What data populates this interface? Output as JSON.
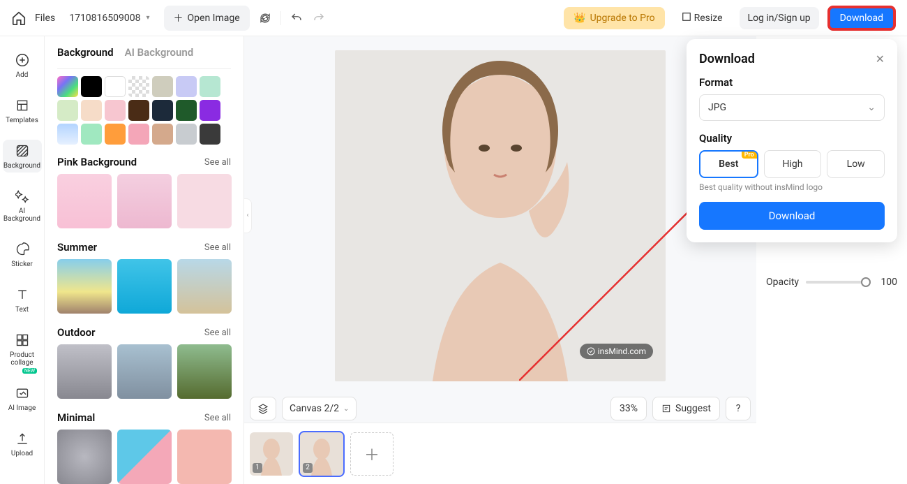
{
  "toolbar": {
    "files": "Files",
    "file_name": "1710816509008",
    "open_image": "Open Image",
    "upgrade": "Upgrade to Pro",
    "resize": "Resize",
    "login": "Log in/Sign up",
    "download": "Download"
  },
  "left_nav": [
    {
      "label": "Add"
    },
    {
      "label": "Templates"
    },
    {
      "label": "Background"
    },
    {
      "label": "AI Background"
    },
    {
      "label": "Sticker"
    },
    {
      "label": "Text"
    },
    {
      "label": "Product collage"
    },
    {
      "label": "AI Image",
      "badge": "NEW"
    },
    {
      "label": "Upload"
    }
  ],
  "bg_panel": {
    "tabs": [
      "Background",
      "AI Background"
    ],
    "swatches": [
      {
        "type": "rainbow"
      },
      {
        "type": "color",
        "color": "#000000"
      },
      {
        "type": "color",
        "color": "#ffffff",
        "selected": true
      },
      {
        "type": "checker"
      },
      {
        "type": "color",
        "color": "#cfcdbd"
      },
      {
        "type": "color",
        "color": "#c8caf5"
      },
      {
        "type": "color",
        "color": "#b6e7d2"
      },
      {
        "type": "color",
        "color": "#d5ebc6"
      },
      {
        "type": "color",
        "color": "#f6dcc8"
      },
      {
        "type": "color",
        "color": "#f7c6d0"
      },
      {
        "type": "color",
        "color": "#4a2c16"
      },
      {
        "type": "color",
        "color": "#1c2a3a"
      },
      {
        "type": "color",
        "color": "#1f5a2a"
      },
      {
        "type": "color",
        "color": "#8a2be2"
      },
      {
        "type": "grad1"
      },
      {
        "type": "color",
        "color": "#a0e8c0"
      },
      {
        "type": "color",
        "color": "#ff9d3b"
      },
      {
        "type": "color",
        "color": "#f4a6b8"
      },
      {
        "type": "color",
        "color": "#d4a98c"
      },
      {
        "type": "color",
        "color": "#c8ccd0"
      },
      {
        "type": "color",
        "color": "#3a3a3a"
      }
    ],
    "sections": [
      {
        "title": "Pink Background",
        "see_all": "See all",
        "thumbs": [
          "t-pink1",
          "t-pink2",
          "t-pink3"
        ]
      },
      {
        "title": "Summer",
        "see_all": "See all",
        "thumbs": [
          "t-sum1",
          "t-sum2",
          "t-sum3"
        ]
      },
      {
        "title": "Outdoor",
        "see_all": "See all",
        "thumbs": [
          "t-out1",
          "t-out2",
          "t-out3"
        ]
      },
      {
        "title": "Minimal",
        "see_all": "See all",
        "thumbs": [
          "t-min1",
          "t-min2",
          "t-min3"
        ]
      }
    ]
  },
  "canvas": {
    "watermark": "insMind.com",
    "canvas_label": "Canvas 2/2",
    "zoom": "33%",
    "suggest": "Suggest",
    "help": "?",
    "thumbs": [
      {
        "num": "1"
      },
      {
        "num": "2",
        "selected": true
      }
    ]
  },
  "right": {
    "opacity_label": "Opacity",
    "opacity_value": "100"
  },
  "download_popover": {
    "title": "Download",
    "format_label": "Format",
    "format_value": "JPG",
    "quality_label": "Quality",
    "q_best": "Best",
    "q_high": "High",
    "q_low": "Low",
    "pro": "Pro",
    "hint": "Best quality without insMind logo",
    "button": "Download"
  }
}
